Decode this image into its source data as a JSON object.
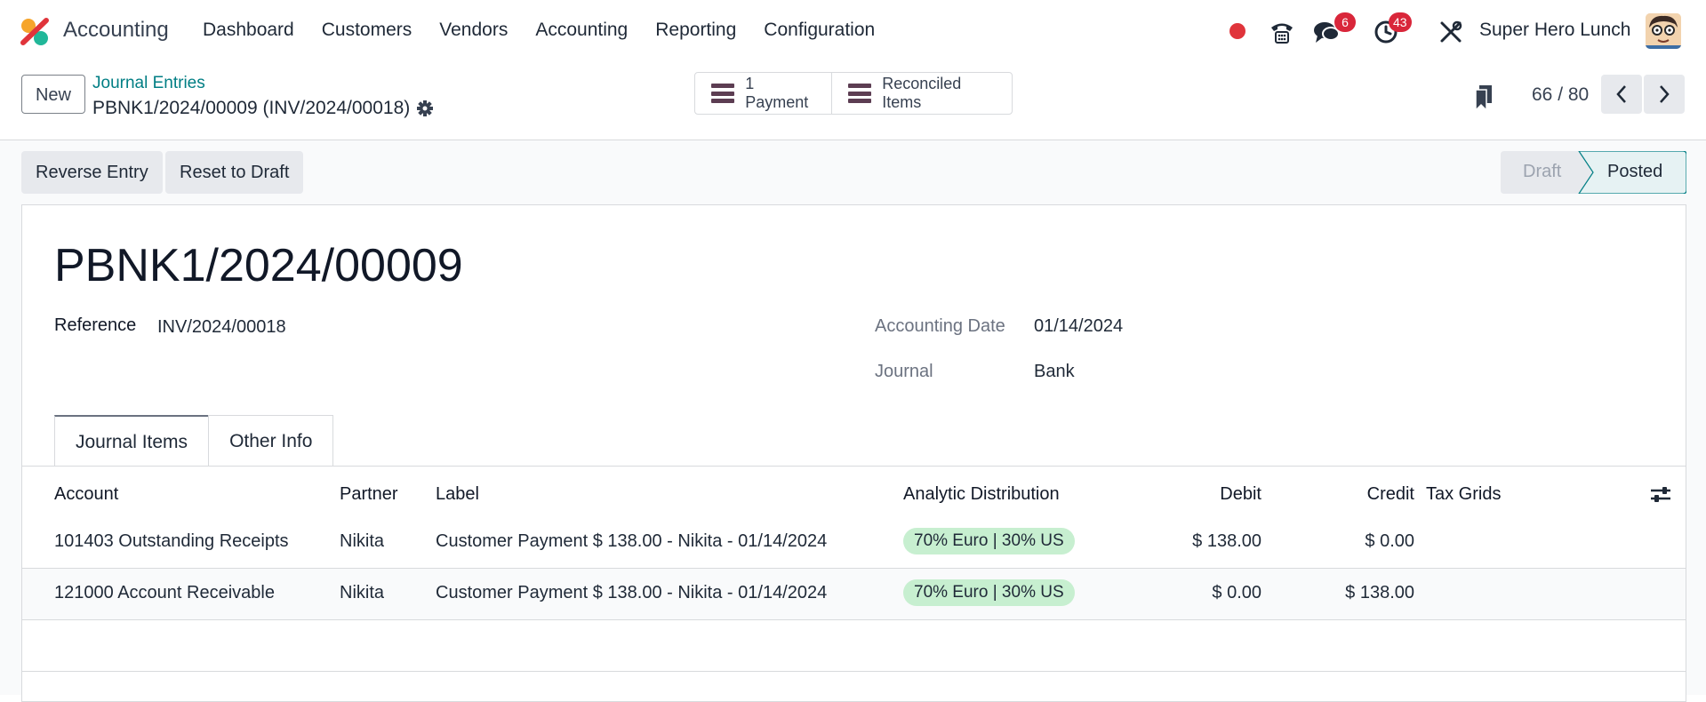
{
  "app": {
    "name": "Accounting",
    "accent": "#017e84",
    "brand_colors": [
      "#f6a52b",
      "#e0343b",
      "#21b799"
    ]
  },
  "menu": [
    "Dashboard",
    "Customers",
    "Vendors",
    "Accounting",
    "Reporting",
    "Configuration"
  ],
  "systray": {
    "discuss_count": "6",
    "activity_count": "43",
    "company": "Super Hero Lunch"
  },
  "breadcrumb": {
    "parent": "Journal Entries",
    "current": "PBNK1/2024/00009 (INV/2024/00018)"
  },
  "buttons": {
    "new": "New"
  },
  "smart_buttons": [
    "1 Payment",
    "Reconciled Items"
  ],
  "pager": {
    "value": "66 / 80"
  },
  "actions": [
    "Reverse Entry",
    "Reset to Draft"
  ],
  "status": {
    "steps": [
      "Draft",
      "Posted"
    ],
    "current": "Posted"
  },
  "record": {
    "title": "PBNK1/2024/00009",
    "reference_label": "Reference",
    "reference": "INV/2024/00018",
    "date_label": "Accounting Date",
    "date": "01/14/2024",
    "journal_label": "Journal",
    "journal": "Bank"
  },
  "tabs": [
    "Journal Items",
    "Other Info"
  ],
  "table": {
    "headers": [
      "Account",
      "Partner",
      "Label",
      "Analytic Distribution",
      "Debit",
      "Credit",
      "Tax Grids"
    ],
    "rows": [
      {
        "account": "101403 Outstanding Receipts",
        "partner": "Nikita",
        "label": "Customer Payment $ 138.00 - Nikita - 01/14/2024",
        "analytic": "70% Euro | 30% US",
        "debit": "$ 138.00",
        "credit": "$ 0.00"
      },
      {
        "account": "121000 Account Receivable",
        "partner": "Nikita",
        "label": "Customer Payment $ 138.00 - Nikita - 01/14/2024",
        "analytic": "70% Euro | 30% US",
        "debit": "$ 0.00",
        "credit": "$ 138.00"
      }
    ]
  }
}
